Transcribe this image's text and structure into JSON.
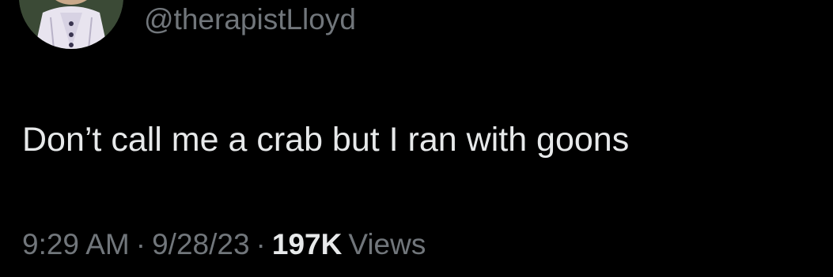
{
  "tweet": {
    "handle": "@therapistLloyd",
    "text": "Don’t call me a crab but I ran with goons",
    "time": "9:29 AM",
    "separator": "·",
    "date": "9/28/23",
    "views_count": "197K",
    "views_label": "Views"
  },
  "colors": {
    "background": "#000000",
    "primary_text": "#e7e9ea",
    "secondary_text": "#71767b"
  }
}
